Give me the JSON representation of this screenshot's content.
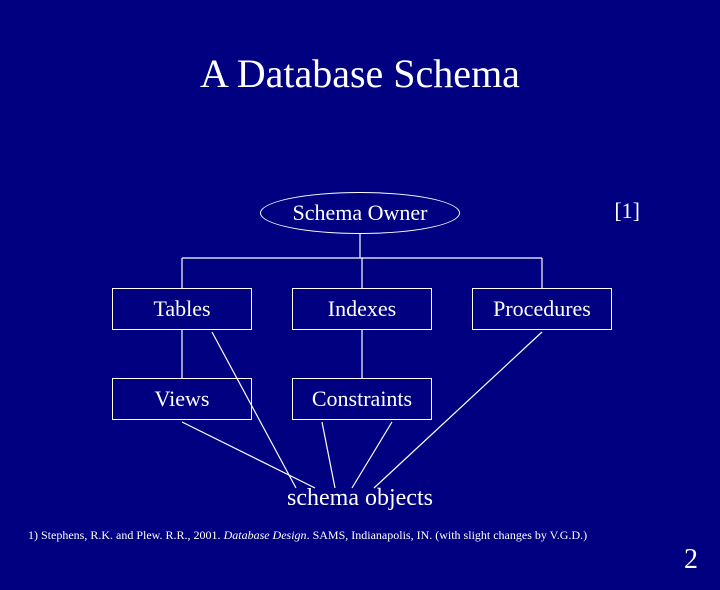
{
  "title": "A Database Schema",
  "citation_marker": "[1]",
  "owner_label": "Schema Owner",
  "objects": {
    "tables": "Tables",
    "indexes": "Indexes",
    "procedures": "Procedures",
    "views": "Views",
    "constraints": "Constraints"
  },
  "caption": "schema objects",
  "citation": {
    "prefix": "1) Stephens, R.K. and Plew. R.R., 2001. ",
    "italic": "Database Design",
    "suffix": ". SAMS, Indianapolis, IN. (with slight changes by V.G.D.)"
  },
  "page_number": "2"
}
